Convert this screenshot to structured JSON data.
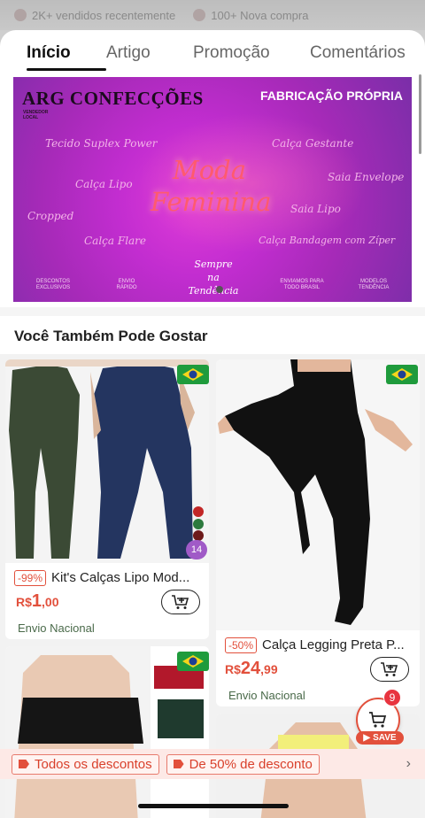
{
  "top_strip": {
    "sold": "2K+ vendidos recentemente",
    "purchases": "100+ Nova compra"
  },
  "tabs": [
    {
      "label": "Início",
      "active": true
    },
    {
      "label": "Artigo",
      "active": false
    },
    {
      "label": "Promoção",
      "active": false
    },
    {
      "label": "Comentários",
      "active": false
    }
  ],
  "banner": {
    "brand": "ARG CONFECÇÕES",
    "brand_sub": "VENDEDOR LOCAL",
    "headline": "FABRICAÇÃO PRÓPRIA",
    "title_line1": "Moda",
    "title_line2": "Feminina",
    "keywords": [
      "Tecido Suplex Power",
      "Calça Gestante",
      "Calça Lipo",
      "Saia Envelope",
      "Cropped",
      "Saia Lipo",
      "Calça Flare",
      "Calça Bandagem com Zíper"
    ],
    "footer": [
      "DESCONTOS EXCLUSIVOS",
      "ENVIO RÁPIDO",
      "ENVIAMOS PARA TODO BRASIL",
      "MODELOS TENDÊNCIA"
    ],
    "slogan_1": "Sempre",
    "slogan_2": "na",
    "slogan_3": "Tendência"
  },
  "section": {
    "title": "Você Também Pode Gostar"
  },
  "products": [
    {
      "discount": "-99%",
      "name": "Kit's Calças Lipo Mod...",
      "currency": "R$",
      "price_int": "1",
      "price_dec": ",00",
      "shipping": "Envio Nacional",
      "color_count": "14"
    },
    {
      "discount": "-50%",
      "name": "Calça Legging Preta P...",
      "currency": "R$",
      "price_int": "24",
      "price_dec": ",99",
      "shipping": "Envio Nacional"
    }
  ],
  "cart": {
    "badge": "9",
    "save_label": "SAVE"
  },
  "promo_bar": {
    "chip_1": "Todos os descontos",
    "chip_2": "De 50% de desconto"
  },
  "colors": {
    "accent": "#e2503c",
    "price": "#e2503c"
  }
}
